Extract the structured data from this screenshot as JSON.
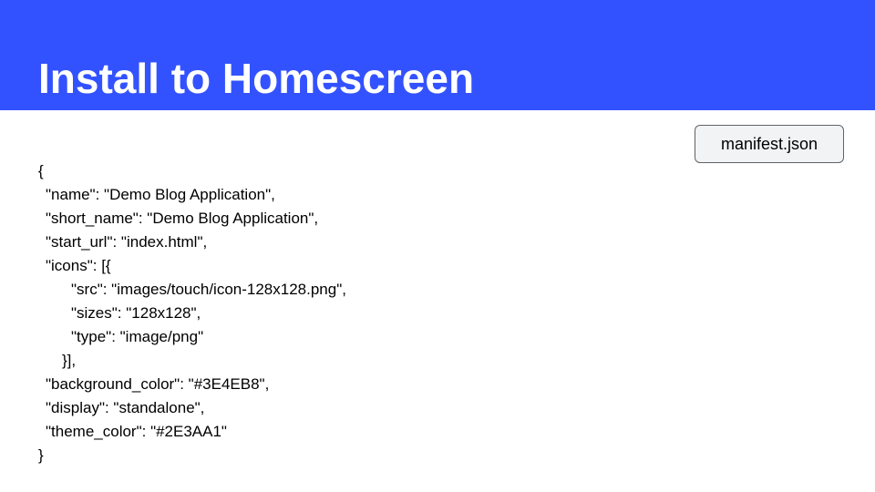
{
  "slide": {
    "title": "Install to Homescreen",
    "file_label": "manifest.json",
    "header_color": "#3352FF"
  },
  "code_lines": [
    "{",
    "\"name\": \"Demo Blog Application\",",
    "\"short_name\": \"Demo Blog Application\",",
    "\"start_url\": \"index.html\",",
    "\"icons\": [{",
    "\"src\": \"images/touch/icon-128x128.png\",",
    "\"sizes\": \"128x128\",",
    "\"type\": \"image/png\"",
    "}],",
    "\"background_color\": \"#3E4EB8\",",
    "\"display\": \"standalone\",",
    "\"theme_color\": \"#2E3AA1\"",
    "}"
  ]
}
